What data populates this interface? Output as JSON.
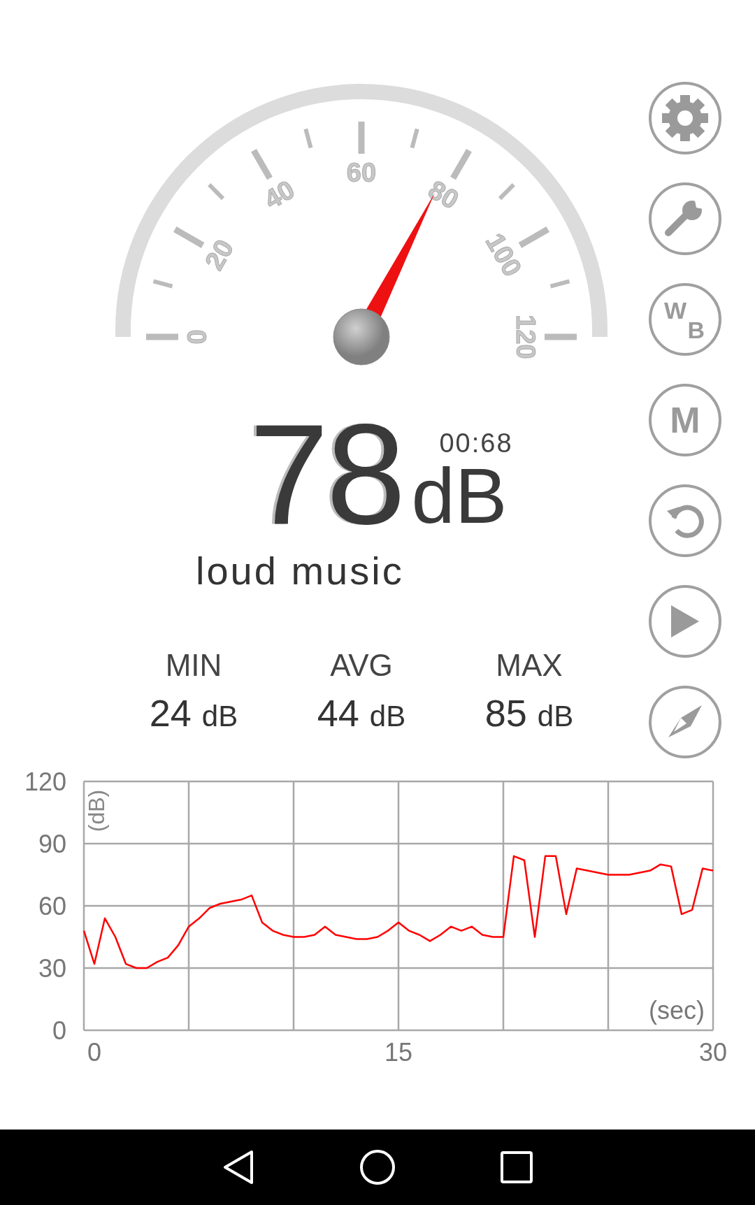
{
  "gauge": {
    "ticks": [
      "0",
      "20",
      "40",
      "60",
      "80",
      "100",
      "120"
    ]
  },
  "reading": {
    "value": "78",
    "unit": "dB",
    "timer": "00:68",
    "description": "loud music"
  },
  "stats": [
    {
      "label": "MIN",
      "value": "24",
      "unit": "dB"
    },
    {
      "label": "AVG",
      "value": "44",
      "unit": "dB"
    },
    {
      "label": "MAX",
      "value": "85",
      "unit": "dB"
    }
  ],
  "toolbar": [
    {
      "kind": "settings"
    },
    {
      "kind": "wrench"
    },
    {
      "kind": "wb",
      "upper": "W",
      "lower": "B"
    },
    {
      "kind": "letter",
      "label": "M"
    },
    {
      "kind": "reset"
    },
    {
      "kind": "play"
    },
    {
      "kind": "compass"
    }
  ],
  "chart": {
    "chart_data": {
      "type": "line",
      "grid": true,
      "ylabel": "(dB)",
      "xlabel": "(sec)",
      "xlim": [
        0,
        30
      ],
      "ylim": [
        0,
        120
      ],
      "xticks": [
        0,
        15,
        30
      ],
      "yticks": [
        0,
        30,
        60,
        90,
        120
      ],
      "x": [
        0,
        0.5,
        1,
        1.5,
        2,
        2.5,
        3,
        3.5,
        4,
        4.5,
        5,
        5.5,
        6,
        6.5,
        7,
        7.5,
        8,
        8.5,
        9,
        9.5,
        10,
        10.5,
        11,
        11.5,
        12,
        12.5,
        13,
        13.5,
        14,
        14.5,
        15,
        15.5,
        16,
        16.5,
        17,
        17.5,
        18,
        18.5,
        19,
        19.5,
        20,
        20.5,
        21,
        21.5,
        22,
        22.5,
        23,
        23.5,
        24,
        24.5,
        25,
        25.5,
        26,
        26.5,
        27,
        27.5,
        28,
        28.5,
        29,
        29.5,
        30
      ],
      "series": [
        {
          "color": "#ff0000",
          "values": [
            48,
            32,
            54,
            45,
            32,
            30,
            30,
            33,
            35,
            41,
            50,
            54,
            59,
            61,
            62,
            63,
            65,
            52,
            48,
            46,
            45,
            45,
            46,
            50,
            46,
            45,
            44,
            44,
            45,
            48,
            52,
            48,
            46,
            43,
            46,
            50,
            48,
            50,
            46,
            45,
            45,
            84,
            82,
            45,
            84,
            84,
            56,
            78,
            77,
            76,
            75,
            75,
            75,
            76,
            77,
            80,
            79,
            56,
            58,
            78,
            77
          ]
        }
      ]
    }
  },
  "nav_bar": [
    {
      "kind": "back"
    },
    {
      "kind": "home"
    },
    {
      "kind": "recents"
    }
  ]
}
